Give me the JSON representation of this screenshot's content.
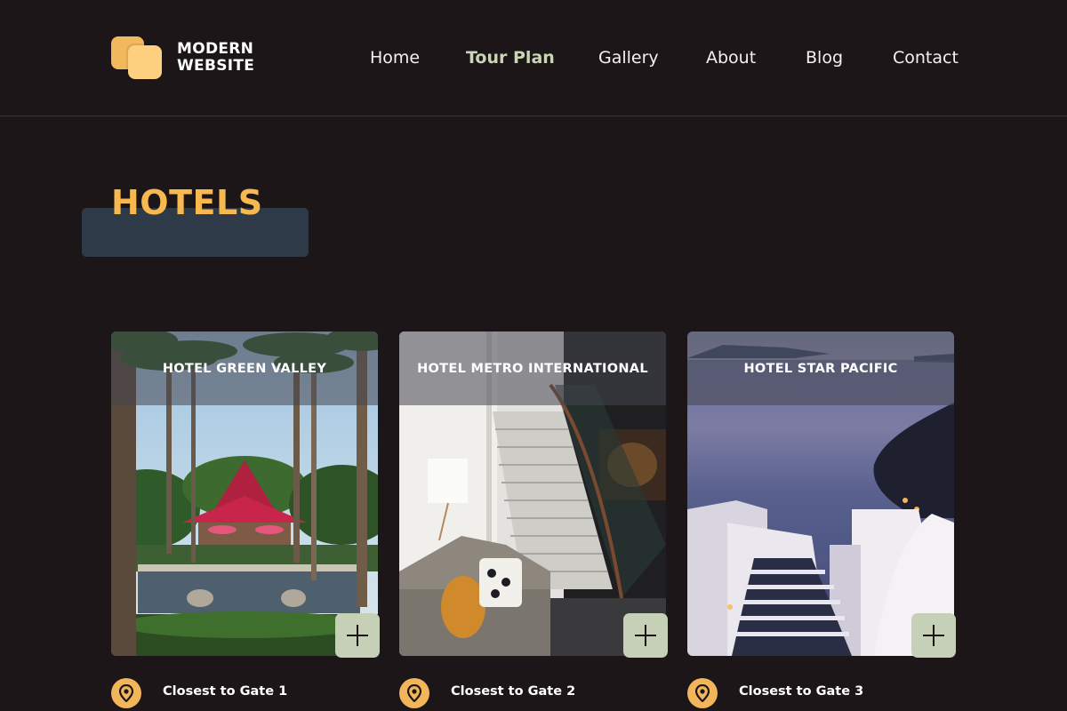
{
  "brand": {
    "line1": "MODERN",
    "line2": "WEBSITE",
    "colors": {
      "primary": "#f2b85c",
      "secondary": "#fdd080"
    }
  },
  "nav": {
    "items": [
      {
        "label": "Home",
        "active": false
      },
      {
        "label": "Tour Plan",
        "active": true
      },
      {
        "label": "Gallery",
        "active": false
      },
      {
        "label": "About",
        "active": false
      },
      {
        "label": "Blog",
        "active": false
      },
      {
        "label": "Contact",
        "active": false
      }
    ]
  },
  "section": {
    "title": "HOTELS",
    "title_color": "#f6b84f"
  },
  "hotels": [
    {
      "name": "HOTEL GREEN VALLEY",
      "location": "Closest to Gate 1",
      "image": "tropical-resort-pool-with-palms"
    },
    {
      "name": "HOTEL METRO INTERNATIONAL",
      "location": "Closest to Gate 2",
      "image": "modern-lobby-with-staircase"
    },
    {
      "name": "HOTEL STAR PACIFIC",
      "location": "Closest to Gate 3",
      "image": "seaside-cliff-terrace-at-dusk"
    }
  ],
  "icons": {
    "add": "plus-icon",
    "location": "map-pin-icon"
  },
  "colors": {
    "background": "#1c1619",
    "accent": "#f2b55a",
    "button": "#c5d0b6",
    "active_nav": "#c9d6b4"
  }
}
